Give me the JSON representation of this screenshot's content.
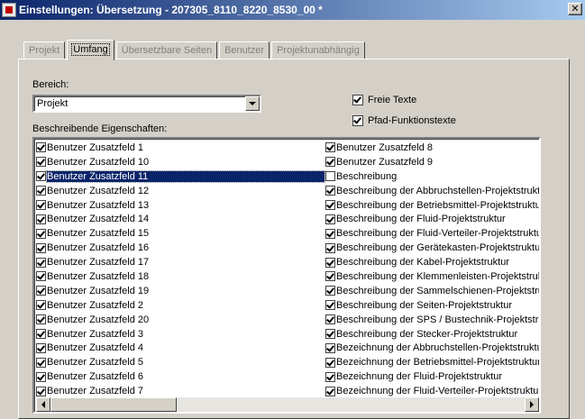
{
  "window": {
    "title": "Einstellungen: Übersetzung - 207305_8110_8220_8530_00 *",
    "close_label": "✕"
  },
  "tabs": [
    {
      "label": "Projekt",
      "active": false
    },
    {
      "label": "Umfang",
      "active": true
    },
    {
      "label": "Übersetzbare Seiten",
      "active": false
    },
    {
      "label": "Benutzer",
      "active": false
    },
    {
      "label": "Projektunabhängig",
      "active": false
    }
  ],
  "bereich": {
    "label": "Bereich:",
    "value": "Projekt"
  },
  "options": {
    "freie_texte": {
      "label": "Freie Texte",
      "checked": true
    },
    "pfad_funktionstexte": {
      "label": "Pfad-Funktionstexte",
      "checked": true
    }
  },
  "properties": {
    "label": "Beschreibende Eigenschaften:",
    "left": [
      {
        "text": "Benutzer Zusatzfeld 1",
        "checked": true
      },
      {
        "text": "Benutzer Zusatzfeld 10",
        "checked": true
      },
      {
        "text": "Benutzer Zusatzfeld 11",
        "checked": true,
        "selected": true
      },
      {
        "text": "Benutzer Zusatzfeld 12",
        "checked": true
      },
      {
        "text": "Benutzer Zusatzfeld 13",
        "checked": true
      },
      {
        "text": "Benutzer Zusatzfeld 14",
        "checked": true
      },
      {
        "text": "Benutzer Zusatzfeld 15",
        "checked": true
      },
      {
        "text": "Benutzer Zusatzfeld 16",
        "checked": true
      },
      {
        "text": "Benutzer Zusatzfeld 17",
        "checked": true
      },
      {
        "text": "Benutzer Zusatzfeld 18",
        "checked": true
      },
      {
        "text": "Benutzer Zusatzfeld 19",
        "checked": true
      },
      {
        "text": "Benutzer Zusatzfeld 2",
        "checked": true
      },
      {
        "text": "Benutzer Zusatzfeld 20",
        "checked": true
      },
      {
        "text": "Benutzer Zusatzfeld 3",
        "checked": true
      },
      {
        "text": "Benutzer Zusatzfeld 4",
        "checked": true
      },
      {
        "text": "Benutzer Zusatzfeld 5",
        "checked": true
      },
      {
        "text": "Benutzer Zusatzfeld 6",
        "checked": true
      },
      {
        "text": "Benutzer Zusatzfeld 7",
        "checked": true
      }
    ],
    "right": [
      {
        "text": "Benutzer Zusatzfeld 8",
        "checked": true
      },
      {
        "text": "Benutzer Zusatzfeld 9",
        "checked": true
      },
      {
        "text": "Beschreibung",
        "checked": false
      },
      {
        "text": "Beschreibung der Abbruchstellen-Projektstruktu",
        "checked": true
      },
      {
        "text": "Beschreibung der Betriebsmittel-Projektstruktur",
        "checked": true
      },
      {
        "text": "Beschreibung der Fluid-Projektstruktur",
        "checked": true
      },
      {
        "text": "Beschreibung der Fluid-Verteiler-Projektstruktur",
        "checked": true
      },
      {
        "text": "Beschreibung der Gerätekasten-Projektstruktur",
        "checked": true
      },
      {
        "text": "Beschreibung der Kabel-Projektstruktur",
        "checked": true
      },
      {
        "text": "Beschreibung der Klemmenleisten-Projektstrukt",
        "checked": true
      },
      {
        "text": "Beschreibung der Sammelschienen-Projektstruk",
        "checked": true
      },
      {
        "text": "Beschreibung der Seiten-Projektstruktur",
        "checked": true
      },
      {
        "text": "Beschreibung der SPS / Bustechnik-Projektstruk",
        "checked": true
      },
      {
        "text": "Beschreibung der Stecker-Projektstruktur",
        "checked": true
      },
      {
        "text": "Bezeichnung der Abbruchstellen-Projektstruktur",
        "checked": true
      },
      {
        "text": "Bezeichnung der Betriebsmittel-Projektstruktur",
        "checked": true
      },
      {
        "text": "Bezeichnung der Fluid-Projektstruktur",
        "checked": true
      },
      {
        "text": "Bezeichnung der Fluid-Verteiler-Projektstruktur",
        "checked": true
      }
    ]
  }
}
